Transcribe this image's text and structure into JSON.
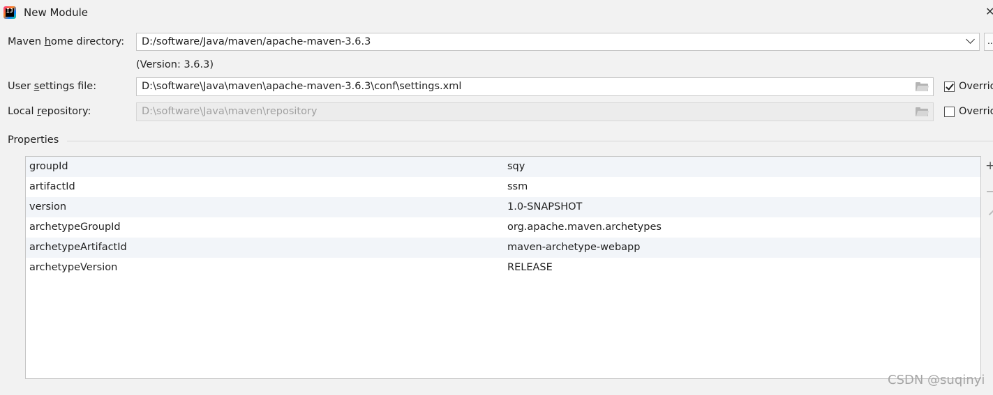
{
  "window": {
    "title": "New Module",
    "close_glyph": "✕",
    "app_icon": "intellij-icon",
    "app_icon_text": "IJ"
  },
  "maven_home": {
    "label_pre": "Maven ",
    "label_mnemonic": "h",
    "label_post": "ome directory:",
    "value": "D:/software/Java/maven/apache-maven-3.6.3",
    "browse_label": "...",
    "version_text": "(Version: 3.6.3)"
  },
  "user_settings": {
    "label_pre": "User ",
    "label_mnemonic": "s",
    "label_post": "ettings file:",
    "value": "D:\\software\\Java\\maven\\apache-maven-3.6.3\\conf\\settings.xml",
    "override_label": "Override",
    "override_checked": true
  },
  "local_repo": {
    "label_pre": "Local ",
    "label_mnemonic": "r",
    "label_post": "epository:",
    "value": "D:\\software\\Java\\maven\\repository",
    "override_label": "Override",
    "override_checked": false
  },
  "properties": {
    "title": "Properties",
    "rows": [
      {
        "key": "groupId",
        "value": "sqy"
      },
      {
        "key": "artifactId",
        "value": "ssm"
      },
      {
        "key": "version",
        "value": "1.0-SNAPSHOT"
      },
      {
        "key": "archetypeGroupId",
        "value": "org.apache.maven.archetypes"
      },
      {
        "key": "archetypeArtifactId",
        "value": "maven-archetype-webapp"
      },
      {
        "key": "archetypeVersion",
        "value": "RELEASE"
      }
    ],
    "add_glyph": "+"
  },
  "watermark": "CSDN @suqinyi",
  "colors": {
    "row_alt": "#f2f5f9",
    "border": "#c6c6c6",
    "background": "#f2f2f2"
  }
}
